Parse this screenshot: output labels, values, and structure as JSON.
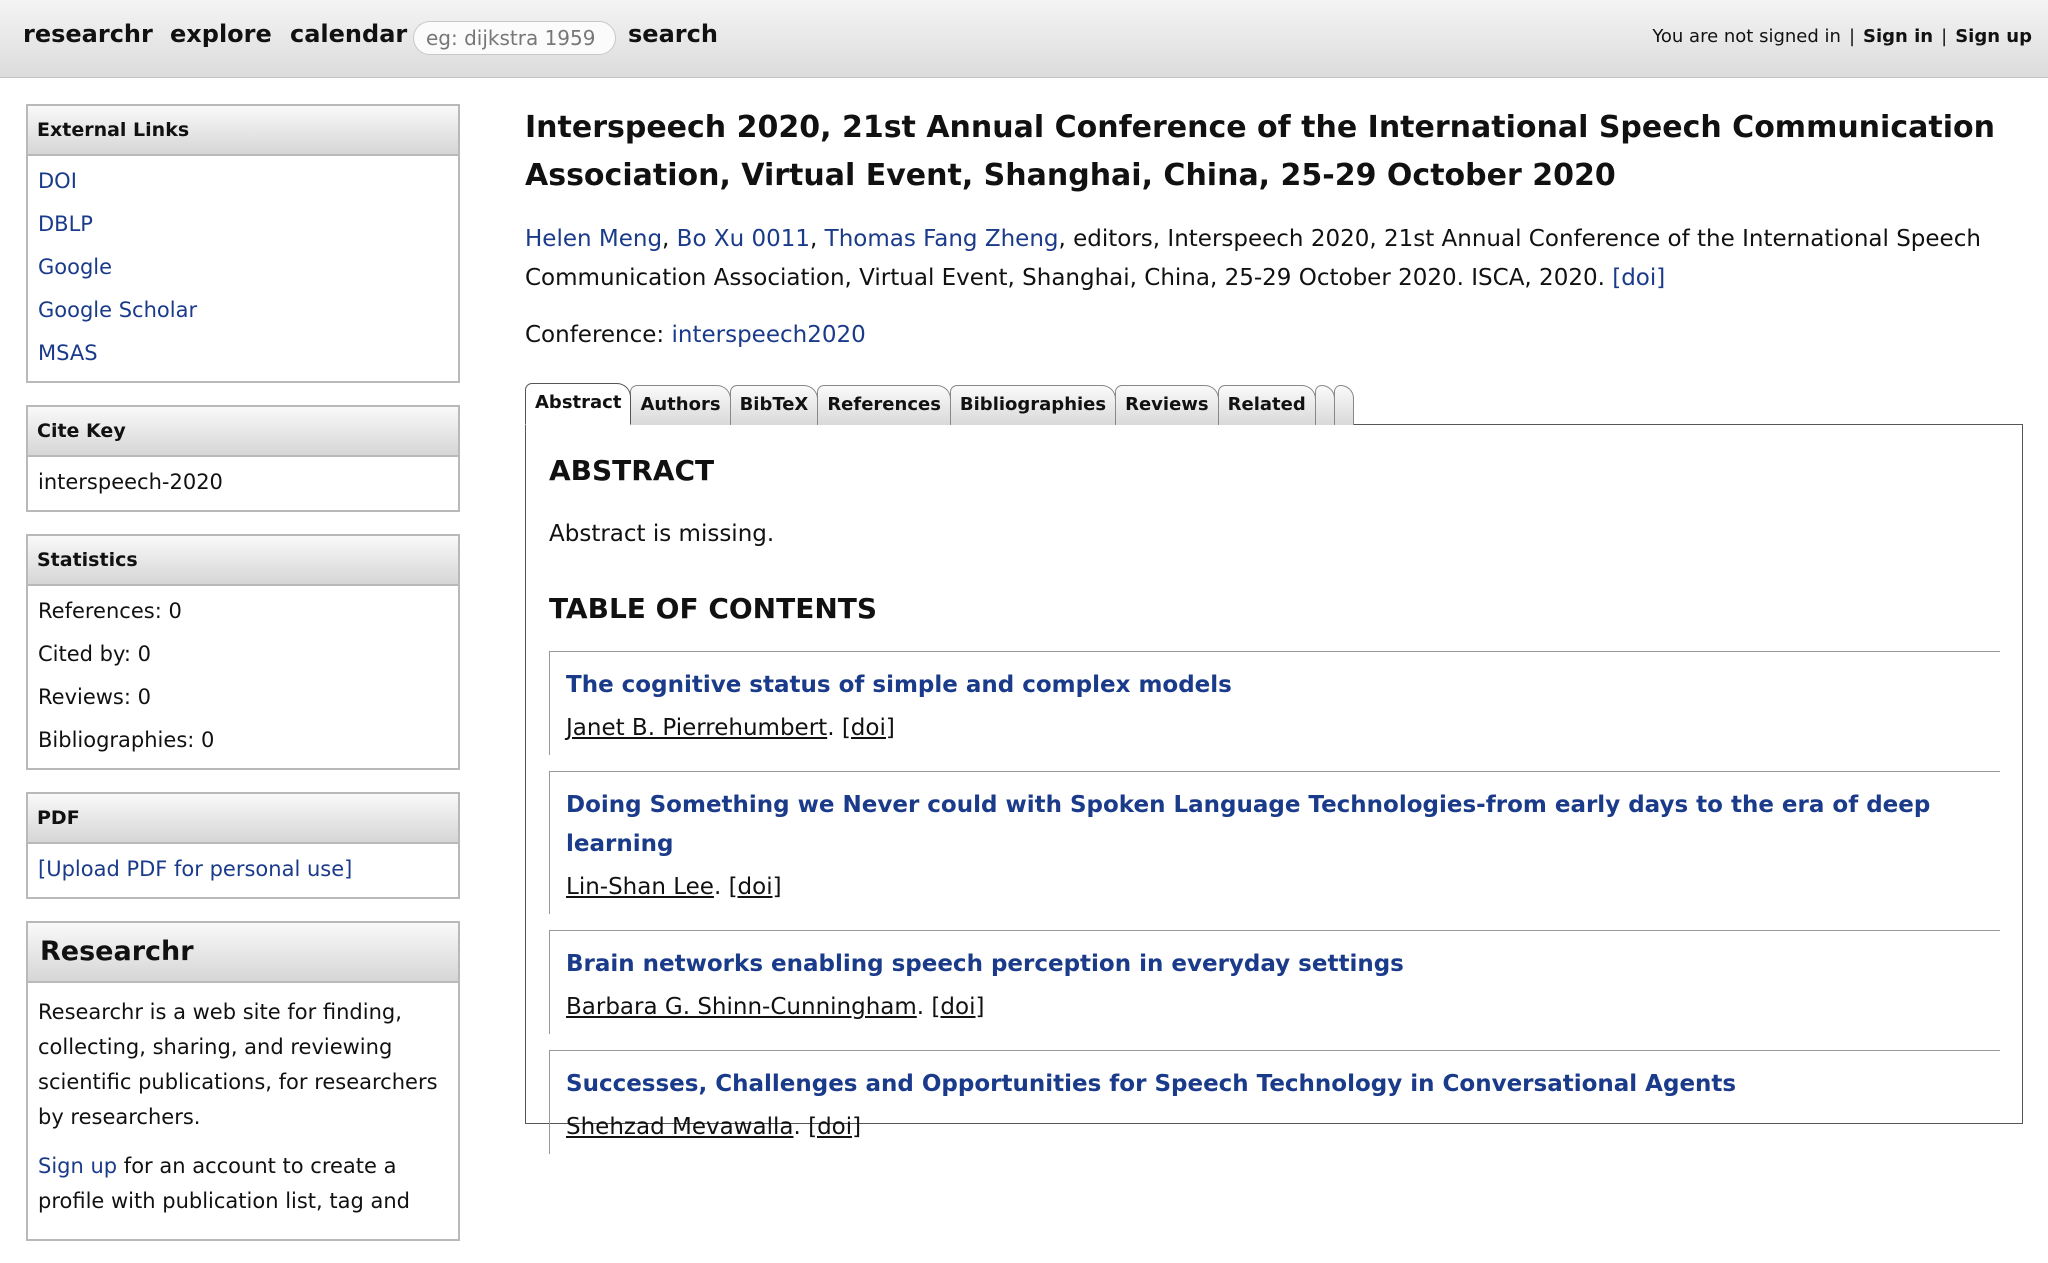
{
  "nav": {
    "brand": "researchr",
    "explore": "explore",
    "calendar": "calendar",
    "search_placeholder": "eg: dijkstra 1959",
    "search_button": "search",
    "signed_status": "You are not signed in",
    "sign_in": "Sign in",
    "sign_up": "Sign up",
    "separator": "|"
  },
  "sidebar": {
    "external_links": {
      "title": "External Links",
      "items": [
        "DOI",
        "DBLP",
        "Google",
        "Google Scholar",
        "MSAS"
      ]
    },
    "cite_key": {
      "title": "Cite Key",
      "value": "interspeech-2020"
    },
    "statistics": {
      "title": "Statistics",
      "items": [
        "References: 0",
        "Cited by: 0",
        "Reviews: 0",
        "Bibliographies: 0"
      ]
    },
    "pdf": {
      "title": "PDF",
      "link": "[Upload PDF for personal use]"
    },
    "researchr": {
      "title": "Researchr",
      "description": "Researchr is a web site for finding, collecting, sharing, and reviewing scientific publications, for researchers by researchers.",
      "signup_link": "Sign up",
      "signup_text": " for an account to create a profile with publication list, tag and"
    }
  },
  "main": {
    "title": "Interspeech 2020, 21st Annual Conference of the International Speech Communication Association, Virtual Event, Shanghai, China, 25-29 October 2020",
    "editors": [
      "Helen Meng",
      "Bo Xu 0011",
      "Thomas Fang Zheng"
    ],
    "comma": ", ",
    "citation_text": ", editors, Interspeech 2020, 21st Annual Conference of the International Speech Communication Association, Virtual Event, Shanghai, China, 25-29 October 2020. ISCA, 2020. ",
    "citation_doi": "[doi]",
    "conference_label": "Conference: ",
    "conference_link": "interspeech2020",
    "tabs": [
      "Abstract",
      "Authors",
      "BibTeX",
      "References",
      "Bibliographies",
      "Reviews",
      "Related"
    ],
    "abstract_heading": "ABSTRACT",
    "abstract_text": "Abstract is missing.",
    "toc_heading": "TABLE OF CONTENTS",
    "doi_label": "[doi]",
    "entry_sep": ". ",
    "entries": [
      {
        "title": "The cognitive status of simple and complex models",
        "author": "Janet B. Pierrehumbert"
      },
      {
        "title": "Doing Something we Never could with Spoken Language Technologies-from early days to the era of deep learning",
        "author": "Lin-Shan Lee"
      },
      {
        "title": "Brain networks enabling speech perception in everyday settings",
        "author": "Barbara G. Shinn-Cunningham"
      },
      {
        "title": "Successes, Challenges and Opportunities for Speech Technology in Conversational Agents",
        "author": "Shehzad Mevawalla"
      }
    ]
  }
}
